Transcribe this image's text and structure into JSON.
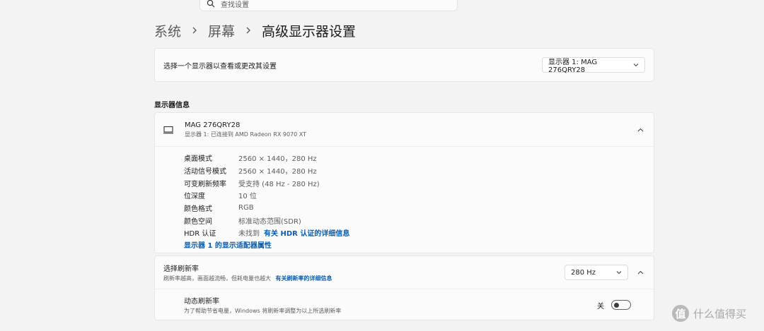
{
  "search": {
    "placeholder": "查找设置"
  },
  "breadcrumb": {
    "items": [
      "系统",
      "屏幕",
      "高级显示器设置"
    ]
  },
  "display_select": {
    "label": "选择一个显示器以查看或更改其设置",
    "selected": "显示器 1: MAG 276QRY28"
  },
  "section_title": "显示器信息",
  "display_info": {
    "name": "MAG 276QRY28",
    "subtitle": "显示器 1: 已连接到 AMD Radeon RX 9070 XT",
    "properties": [
      {
        "key": "桌面模式",
        "value": "2560 × 1440，280 Hz"
      },
      {
        "key": "活动信号模式",
        "value": "2560 × 1440，280 Hz"
      },
      {
        "key": "可变刷新频率",
        "value": "受支持 (48 Hz - 280 Hz)"
      },
      {
        "key": "位深度",
        "value": "10 位"
      },
      {
        "key": "颜色格式",
        "value": "RGB"
      },
      {
        "key": "颜色空间",
        "value": "标准动态范围(SDR)"
      },
      {
        "key": "HDR 认证",
        "value": "未找到",
        "link": "有关 HDR 认证的详细信息"
      }
    ],
    "adapter_link": "显示器 1 的显示适配器属性"
  },
  "refresh_rate": {
    "title": "选择刷新率",
    "subtitle": "刷新率越高，画面越流畅，但耗电量也越大",
    "link": "有关刷新率的详细信息",
    "selected": "280 Hz"
  },
  "dynamic_refresh": {
    "title": "动态刷新率",
    "subtitle": "为了帮助节省电量，Windows 将刷新率调整为以上所选刷新率",
    "state_label": "关"
  },
  "watermark": {
    "logo": "值",
    "text": "什么值得买"
  },
  "colors": {
    "accent": "#0b5cad",
    "background": "#f3f3f3",
    "card": "#fbfbfb"
  }
}
